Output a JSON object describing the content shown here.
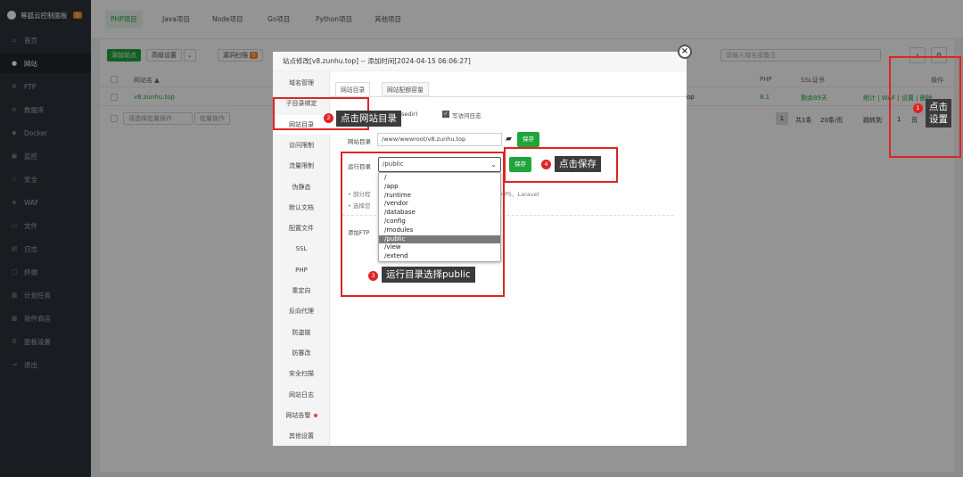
{
  "sidebar": {
    "brand": "尊狐云控制面板",
    "brand_badge": "0",
    "items": [
      {
        "label": "首页",
        "icon": "home-icon",
        "glyph": "⌂"
      },
      {
        "label": "网站",
        "icon": "globe-icon",
        "glyph": "●"
      },
      {
        "label": "FTP",
        "icon": "ftp-icon",
        "glyph": "⊕"
      },
      {
        "label": "数据库",
        "icon": "database-icon",
        "glyph": "≡"
      },
      {
        "label": "Docker",
        "icon": "docker-icon",
        "glyph": "◆"
      },
      {
        "label": "监控",
        "icon": "monitor-icon",
        "glyph": "▣"
      },
      {
        "label": "安全",
        "icon": "shield-icon",
        "glyph": "◇"
      },
      {
        "label": "WAF",
        "icon": "waf-icon",
        "glyph": "◈"
      },
      {
        "label": "文件",
        "icon": "folder-icon",
        "glyph": "▭"
      },
      {
        "label": "日志",
        "icon": "log-icon",
        "glyph": "▤"
      },
      {
        "label": "终端",
        "icon": "terminal-icon",
        "glyph": "▢"
      },
      {
        "label": "计划任务",
        "icon": "schedule-icon",
        "glyph": "▦"
      },
      {
        "label": "软件商店",
        "icon": "store-icon",
        "glyph": "▩"
      },
      {
        "label": "面板设置",
        "icon": "gear-icon",
        "glyph": "⚙"
      },
      {
        "label": "退出",
        "icon": "logout-icon",
        "glyph": "⇥"
      }
    ]
  },
  "project_tabs": [
    "PHP项目",
    "Java项目",
    "Node项目",
    "Go项目",
    "Python项目",
    "其他项目"
  ],
  "toolbar": {
    "add_site": "添加站点",
    "advanced": "高级设置",
    "vuln_scan": "漏洞扫描",
    "vuln_count": "0",
    "search_placeholder": "请输入域名或备注"
  },
  "table": {
    "col_name": "网站名 ▲",
    "col_php": "PHP",
    "col_ssl": "SSL证书",
    "col_ops": "操作",
    "row": {
      "name": "v8.zunhu.top",
      "dir_tail": "op",
      "php": "8.1",
      "ssl": "剩余89天",
      "ops": "统计 | WAF | 设置 | 删除"
    },
    "batch_placeholder": "请选择批量操作",
    "batch_btn": "批量操作",
    "page_num": "1",
    "total": "共1条",
    "per_page": "20条/页",
    "goto": "跳转到",
    "goto_val": "1",
    "page_unit": "页"
  },
  "modal": {
    "title": "站点修改[v8.zunhu.top] -- 添加时间[2024-04-15 06:06:27]",
    "nav": [
      "域名管理",
      "子目录绑定",
      "网站目录",
      "访问限制",
      "流量限制",
      "伪静态",
      "默认文档",
      "配置文件",
      "SSL",
      "PHP",
      "重定向",
      "反向代理",
      "防盗链",
      "防篡改",
      "安全扫描",
      "网站日志",
      "网站告警",
      "其他设置"
    ],
    "subtabs": [
      "网站目录",
      "网站配额容量"
    ],
    "anti_xss_partial": "asedir)",
    "write_log": "写访问日志",
    "site_dir_label": "网站目录",
    "site_dir_value": "/www/wwwroot/v8.zunhu.top",
    "save": "保存",
    "run_dir_label": "运行目录",
    "run_dir_value": "/public",
    "hint1_partial": "部分程",
    "hint1_tail": "HP5、Laravel",
    "hint2_partial": "选择您",
    "add_ftp": "添加FTP",
    "dropdown_options": [
      "/",
      "/app",
      "/runtime",
      "/vendor",
      "/database",
      "/config",
      "/modules",
      "/public",
      "/view",
      "/extend"
    ],
    "selected_option": "/public"
  },
  "annotations": [
    {
      "num": "1",
      "text": "点击\n设置"
    },
    {
      "num": "2",
      "text": "点击网站目录"
    },
    {
      "num": "3",
      "text": "运行目录选择public"
    },
    {
      "num": "4",
      "text": "点击保存"
    }
  ],
  "colors": {
    "accent": "#20a53a",
    "annotation": "#e02424",
    "sidebar": "#2c3138"
  }
}
